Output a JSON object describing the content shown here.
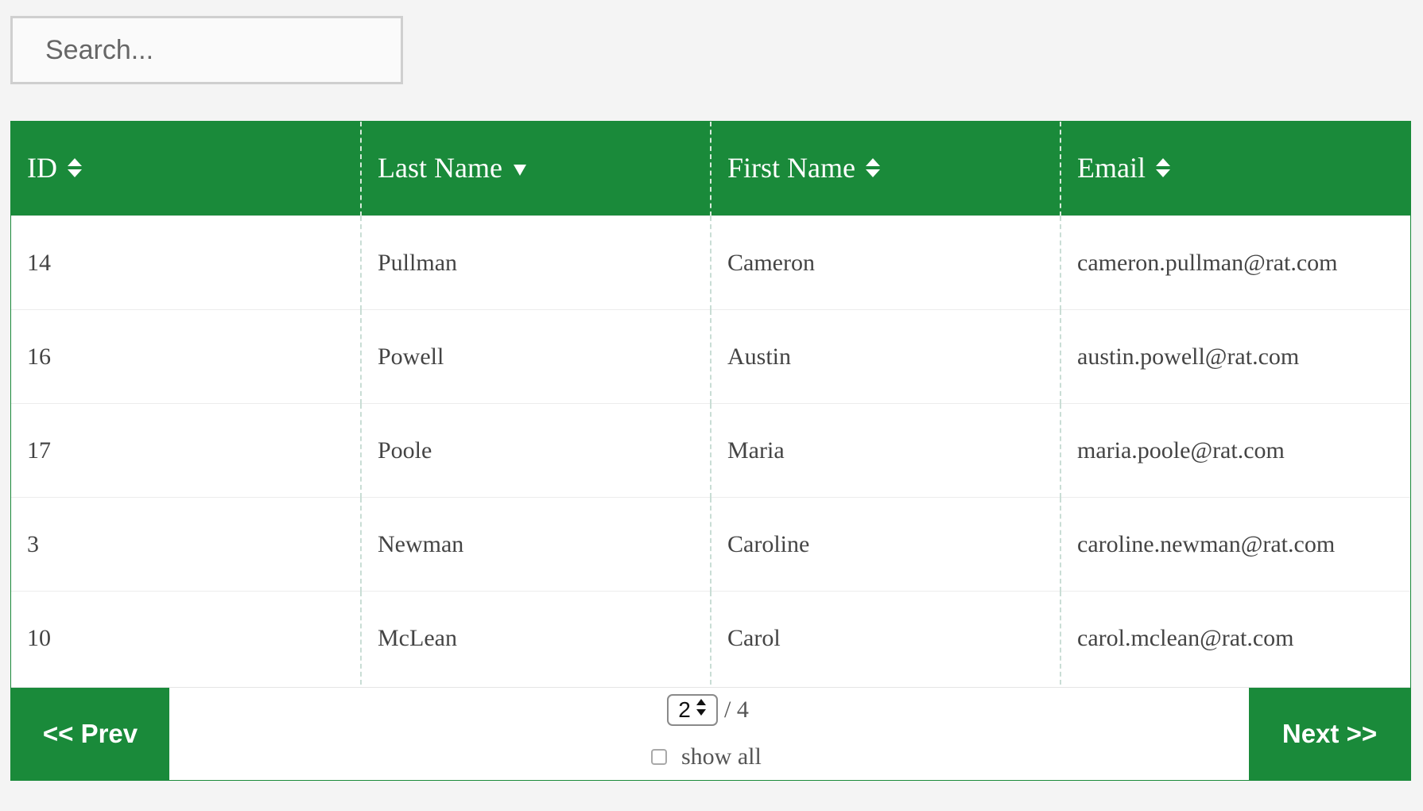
{
  "search": {
    "placeholder": "Search..."
  },
  "table": {
    "columns": [
      {
        "label": "ID",
        "sort_icon": "sort-both-icon"
      },
      {
        "label": "Last Name",
        "sort_icon": "sort-desc-icon"
      },
      {
        "label": "First Name",
        "sort_icon": "sort-both-icon"
      },
      {
        "label": "Email",
        "sort_icon": "sort-both-icon"
      }
    ],
    "rows": [
      [
        "14",
        "Pullman",
        "Cameron",
        "cameron.pullman@rat.com"
      ],
      [
        "16",
        "Powell",
        "Austin",
        "austin.powell@rat.com"
      ],
      [
        "17",
        "Poole",
        "Maria",
        "maria.poole@rat.com"
      ],
      [
        "3",
        "Newman",
        "Caroline",
        "caroline.newman@rat.com"
      ],
      [
        "10",
        "McLean",
        "Carol",
        "carol.mclean@rat.com"
      ]
    ]
  },
  "pagination": {
    "prev_label": "<< Prev",
    "next_label": "Next >>",
    "current_page": "2",
    "total_pages": "/ 4",
    "show_all_label": "show all"
  },
  "colors": {
    "accent": "#1a8a3a"
  }
}
